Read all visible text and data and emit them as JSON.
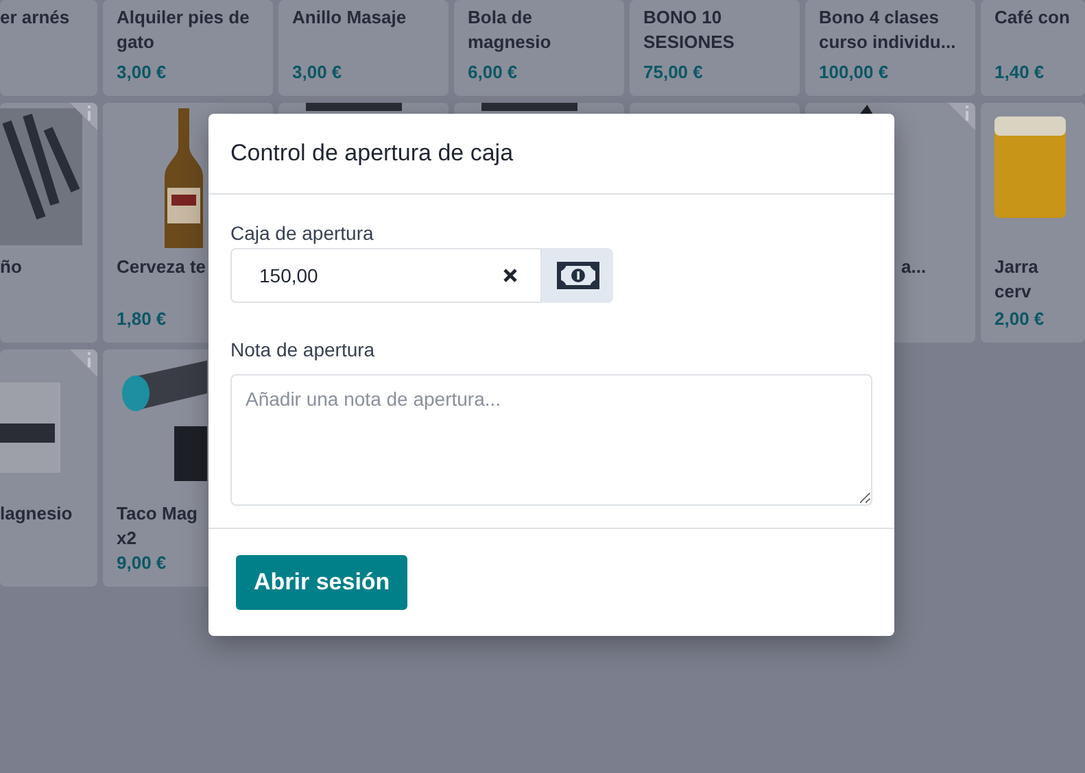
{
  "product_rows": [
    {
      "products": [
        {
          "name": "er arnés"
        },
        {
          "name": "Alquiler pies de gato",
          "price": "3,00 €"
        },
        {
          "name": "Anillo Masaje",
          "price": "3,00 €"
        },
        {
          "name": "Bola de magnesio",
          "price": "6,00 €"
        },
        {
          "name": "BONO 10 SESIONES",
          "price": "75,00 €"
        },
        {
          "name": "Bono 4 clases curso individu...",
          "price": "100,00 €"
        },
        {
          "name": "Café con",
          "price": "1,40 €"
        }
      ]
    },
    {
      "products": [
        {
          "name": "ño"
        },
        {
          "name": "Cerveza te",
          "price": "1,80 €"
        },
        {
          "name": "a..."
        },
        {
          "name": "Jarra cerv",
          "price": "2,00 €"
        }
      ]
    },
    {
      "products": [
        {
          "name": "lagnesio"
        },
        {
          "name": "Taco Mag x2",
          "price": "9,00 €"
        }
      ]
    }
  ],
  "dialog": {
    "title": "Control de apertura de caja",
    "cash": {
      "label": "Caja de apertura",
      "value": "150,00"
    },
    "note": {
      "label": "Nota de apertura",
      "placeholder": "Añadir una nota de apertura..."
    },
    "submit": "Abrir sesión"
  }
}
